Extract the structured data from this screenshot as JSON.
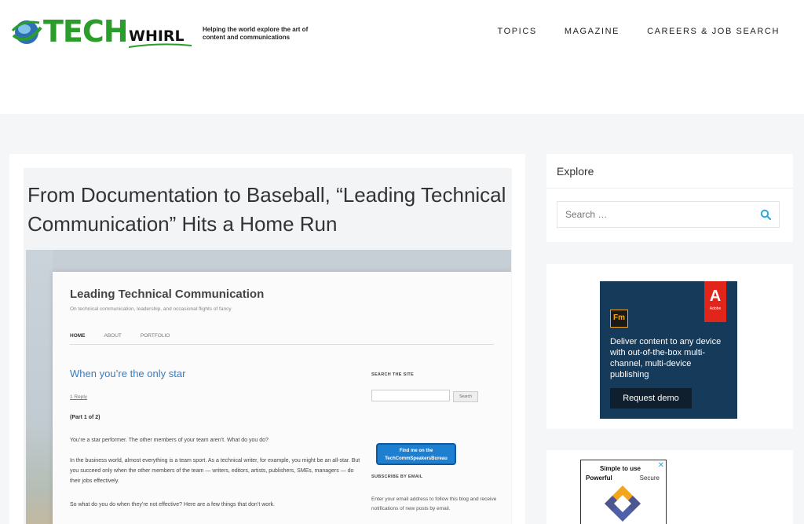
{
  "header": {
    "logo_main": "TECH",
    "logo_sub": "WHIRL",
    "tagline": "Helping the world explore the art of content and communications",
    "nav": [
      "TOPICS",
      "MAGAZINE",
      "CAREERS & JOB SEARCH"
    ]
  },
  "article": {
    "title": "From Documentation to Baseball, “Leading Technical Communication” Hits a Home Run"
  },
  "screenshot": {
    "blog_title": "Leading Technical Communication",
    "blog_subtitle": "On technical communication, leadership, and occasional flights of fancy",
    "nav": [
      "HOME",
      "ABOUT",
      "PORTFOLIO"
    ],
    "post_title": "When you’re the only star",
    "reply": "1 Reply",
    "part": "(Part 1 of 2)",
    "p1": "You’re a star performer. The other members of your team aren’t. What do you do?",
    "p2": "In the business world, almost everything is a team sport. As a technical writer, for example, you might be an all-star. But you succeed only when the other members of the team — writers, editors, artists, publishers, SMEs, managers — do their jobs effectively.",
    "p3": "So what do you do when they’re not effective? Here are a few things that don’t work.",
    "search_head": "SEARCH THE SITE",
    "search_btn": "Search",
    "badge": "Find me on the TechCommSpeakersBureau",
    "subscribe_head": "SUBSCRIBE BY EMAIL",
    "subscribe_text": "Enter your email address to follow this blog and receive notifications of new posts by email."
  },
  "sidebar": {
    "explore_title": "Explore",
    "search_placeholder": "Search …",
    "ad1": {
      "product": "Fm",
      "brand": "Adobe",
      "copy": "Deliver content to any device with out-of-the-box multi-channel, multi-device publishing",
      "button": "Request demo"
    },
    "ad2": {
      "line1": "Simple to use",
      "line2": "Powerful",
      "line3": "Secure",
      "close": "✕"
    }
  },
  "colors": {
    "logo_green": "#2a9d2a",
    "link_blue": "#3a7bbd",
    "search_icon": "#29a8e0",
    "ad_bg": "#163a5a",
    "adobe_red": "#e1251b"
  }
}
